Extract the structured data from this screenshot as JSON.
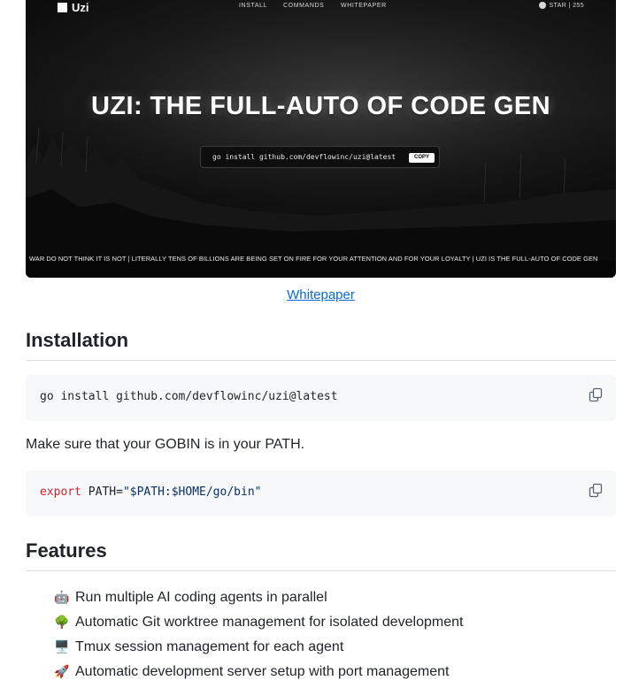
{
  "hero": {
    "logo_text": "Uzi",
    "nav": [
      "INSTALL",
      "COMMANDS",
      "WHITEPAPER"
    ],
    "star_text": "STAR | 255",
    "title": "UZI: THE FULL-AUTO OF CODE GEN",
    "install_command": "go install github.com/devflowinc/uzi@latest",
    "copy_label": "COPY",
    "ticker": "WAR DO NOT THINK IT IS NOT | LITERALLY TENS OF BILLIONS ARE BEING SET ON FIRE FOR YOUR ATTENTION AND FOR YOUR LOYALTY | UZI IS THE FULL-AUTO OF CODE GEN"
  },
  "whitepaper_link": "Whitepaper",
  "installation": {
    "heading": "Installation",
    "code_1": "go install github.com/devflowinc/uzi@latest",
    "paragraph": "Make sure that your GOBIN is in your PATH.",
    "code_2": {
      "keyword": "export",
      "var": " PATH=",
      "string": "\"$PATH:$HOME/go/bin\""
    }
  },
  "features": {
    "heading": "Features",
    "items": [
      {
        "icon": "🤖",
        "icon_name": "robot-icon",
        "text": "Run multiple AI coding agents in parallel"
      },
      {
        "icon": "🌳",
        "icon_name": "tree-icon",
        "text": "Automatic Git worktree management for isolated development"
      },
      {
        "icon": "🖥️",
        "icon_name": "desktop-computer-icon",
        "text": "Tmux session management for each agent"
      },
      {
        "icon": "🚀",
        "icon_name": "rocket-icon",
        "text": "Automatic development server setup with port management"
      }
    ]
  },
  "colors": {
    "link": "#0969da",
    "code_bg": "#f6f8fa",
    "keyword": "#cf222e",
    "string": "#0a3069"
  }
}
